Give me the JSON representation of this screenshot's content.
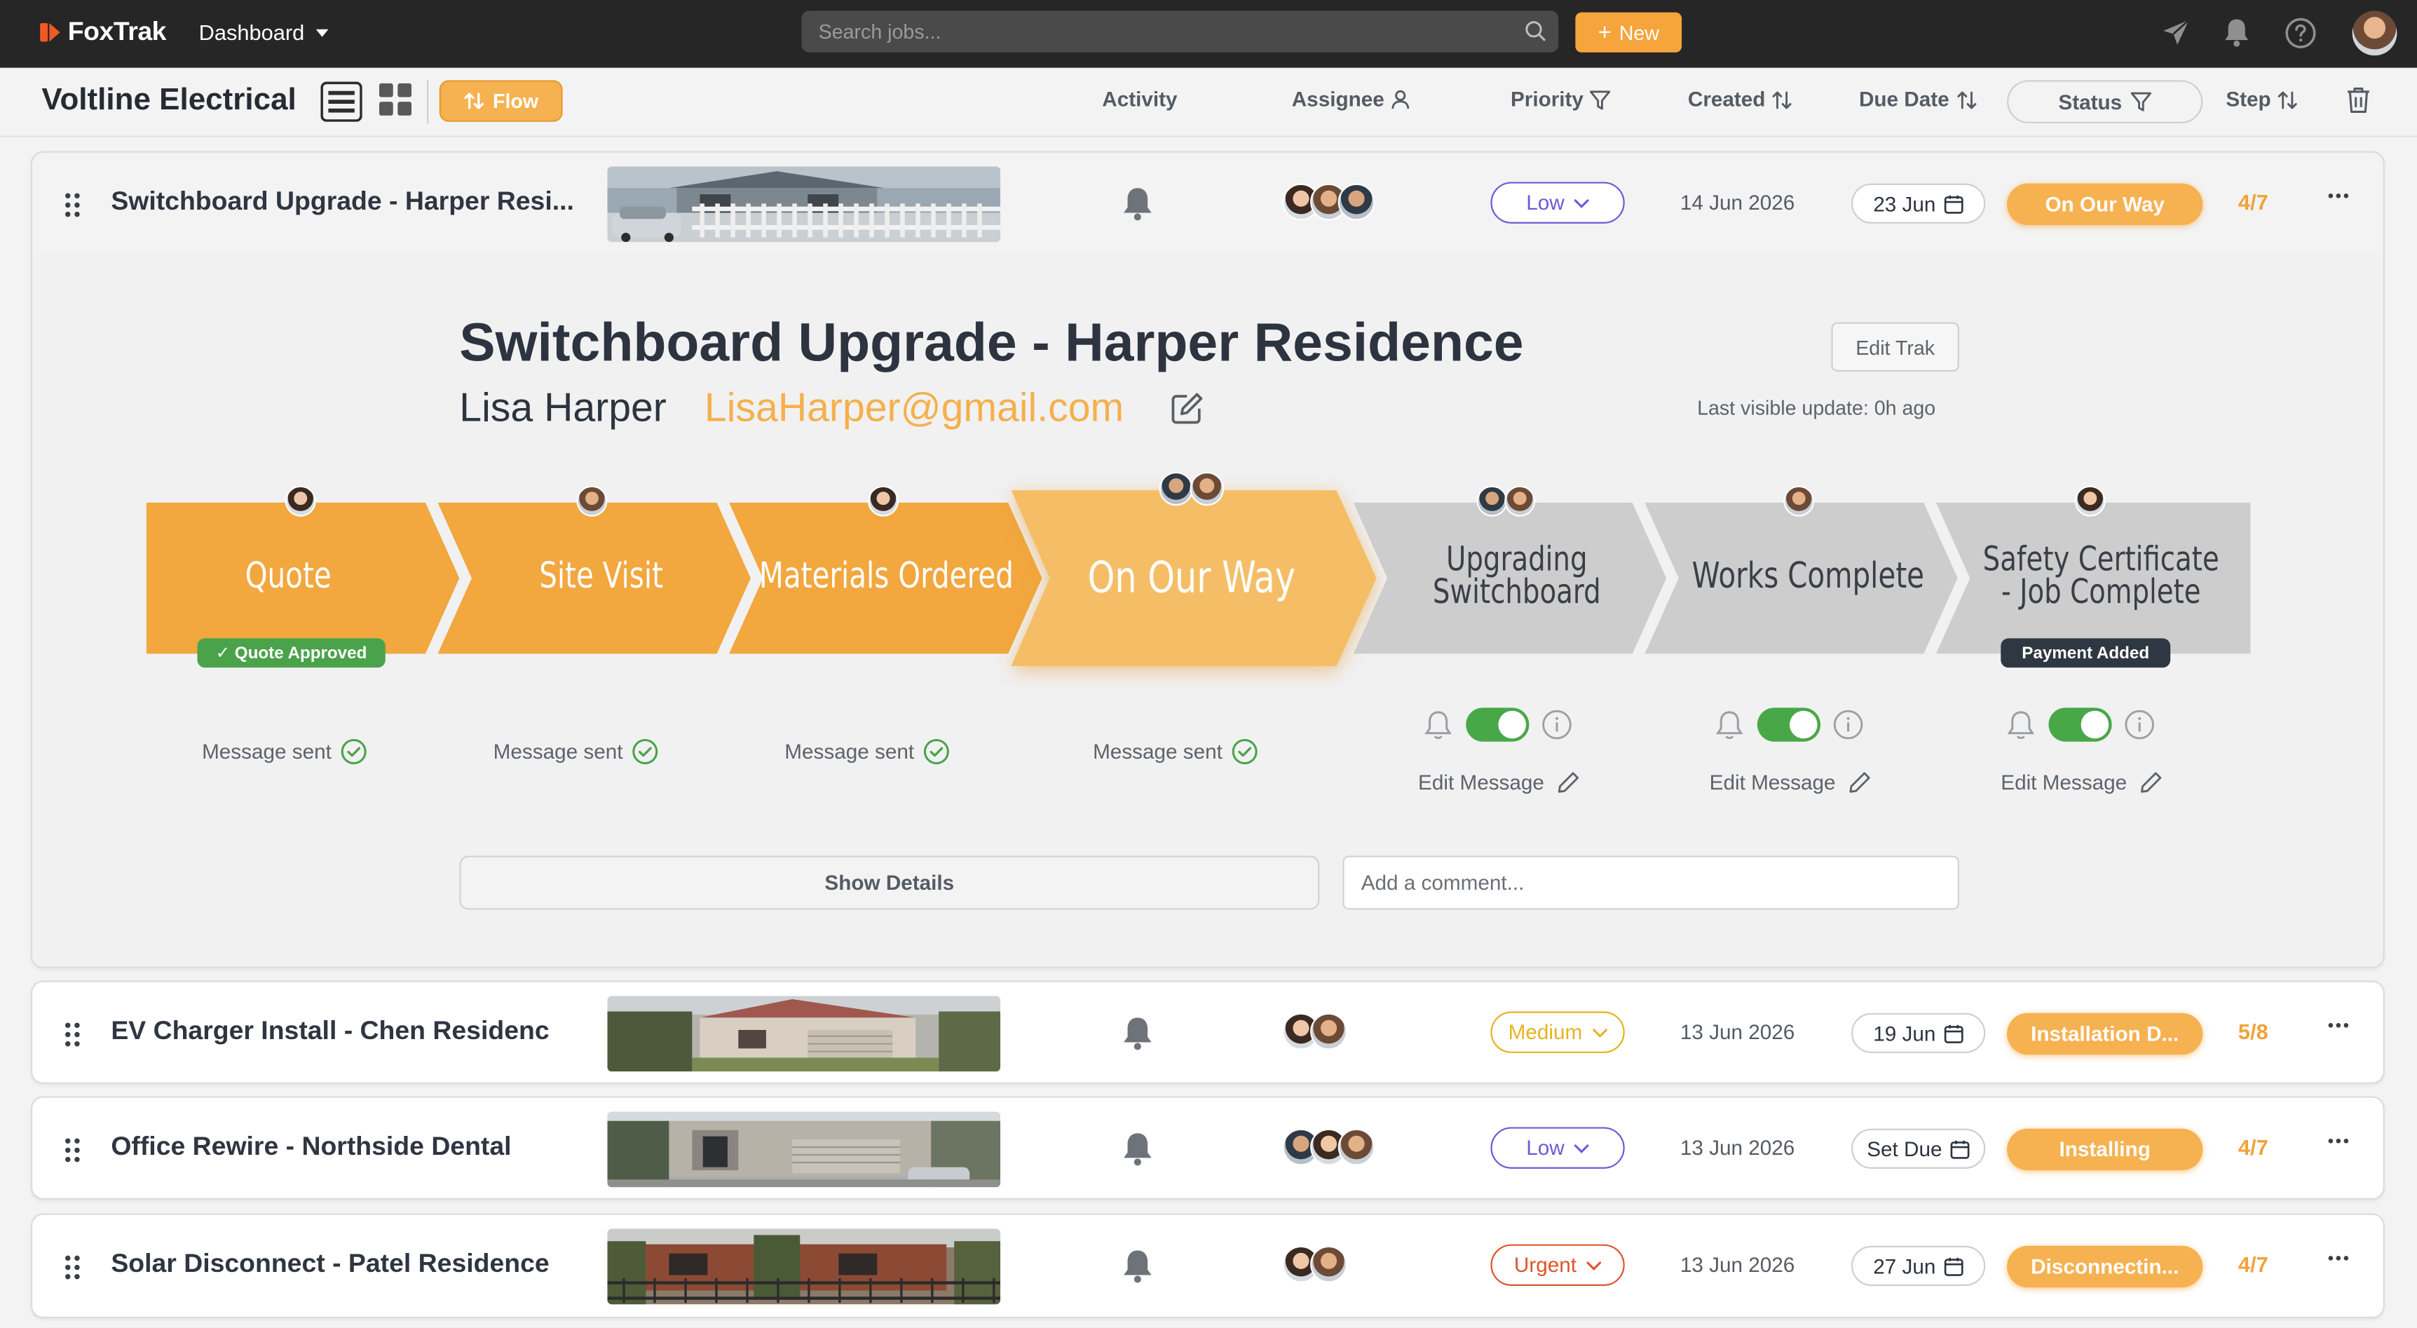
{
  "app": {
    "brand": "FoxTrak",
    "nav_label": "Dashboard",
    "search_placeholder": "Search jobs...",
    "new_button": "New"
  },
  "header": {
    "company": "Voltline Electrical",
    "flow_button": "Flow",
    "columns": {
      "activity": "Activity",
      "assignee": "Assignee",
      "priority": "Priority",
      "created": "Created",
      "due_date": "Due Date",
      "status": "Status",
      "step": "Step"
    }
  },
  "colors": {
    "accent": "#f6b150",
    "brand": "#ef5a24",
    "active_stage": "#f5be66",
    "done_stage": "#f2a73f",
    "pending_stage": "#cdcdcd",
    "toggle_on": "#48a848"
  },
  "jobs": [
    {
      "title": "Switchboard Upgrade - Harper Resi...",
      "priority": "Low",
      "priority_color": "#6b5bd6",
      "created": "14 Jun 2026",
      "due": "23 Jun",
      "status": "On Our Way",
      "step": "4/7",
      "assignee_count": 3
    },
    {
      "title": "EV Charger Install - Chen Residenc",
      "priority": "Medium",
      "priority_color": "#e6b320",
      "created": "13 Jun 2026",
      "due": "19 Jun",
      "status": "Installation D...",
      "step": "5/8",
      "assignee_count": 2
    },
    {
      "title": "Office Rewire - Northside Dental",
      "priority": "Low",
      "priority_color": "#6b5bd6",
      "created": "13 Jun 2026",
      "due": "Set Due",
      "status": "Installing",
      "step": "4/7",
      "assignee_count": 3
    },
    {
      "title": "Solar Disconnect - Patel Residence",
      "priority": "Urgent",
      "priority_color": "#e0532b",
      "created": "13 Jun 2026",
      "due": "27 Jun",
      "status": "Disconnectin...",
      "step": "4/7",
      "assignee_count": 2
    }
  ],
  "detail": {
    "title": "Switchboard Upgrade - Harper Residence",
    "customer": "Lisa Harper",
    "email": "LisaHarper@gmail.com",
    "edit_trak": "Edit Trak",
    "last_update": "Last visible update: 0h ago",
    "stages": [
      {
        "label": "Quote",
        "state": "done",
        "badge": "✓ Quote Approved",
        "note": "Message sent"
      },
      {
        "label": "Site Visit",
        "state": "done",
        "note": "Message sent"
      },
      {
        "label": "Materials Ordered",
        "state": "done",
        "note": "Message sent"
      },
      {
        "label": "On Our Way",
        "state": "active",
        "note": "Message sent"
      },
      {
        "label": "Upgrading Switchboard",
        "label_line1": "Upgrading",
        "label_line2": "Switchboard",
        "state": "pending",
        "note": "Edit Message"
      },
      {
        "label": "Works Complete",
        "state": "pending",
        "note": "Edit Message"
      },
      {
        "label": "Safety Certificate - Job Complete",
        "label_line1": "Safety Certificate",
        "label_line2": "- Job Complete",
        "state": "pending",
        "badge": "Payment Added",
        "note": "Edit Message"
      }
    ],
    "show_details": "Show Details",
    "comment_placeholder": "Add a comment..."
  }
}
